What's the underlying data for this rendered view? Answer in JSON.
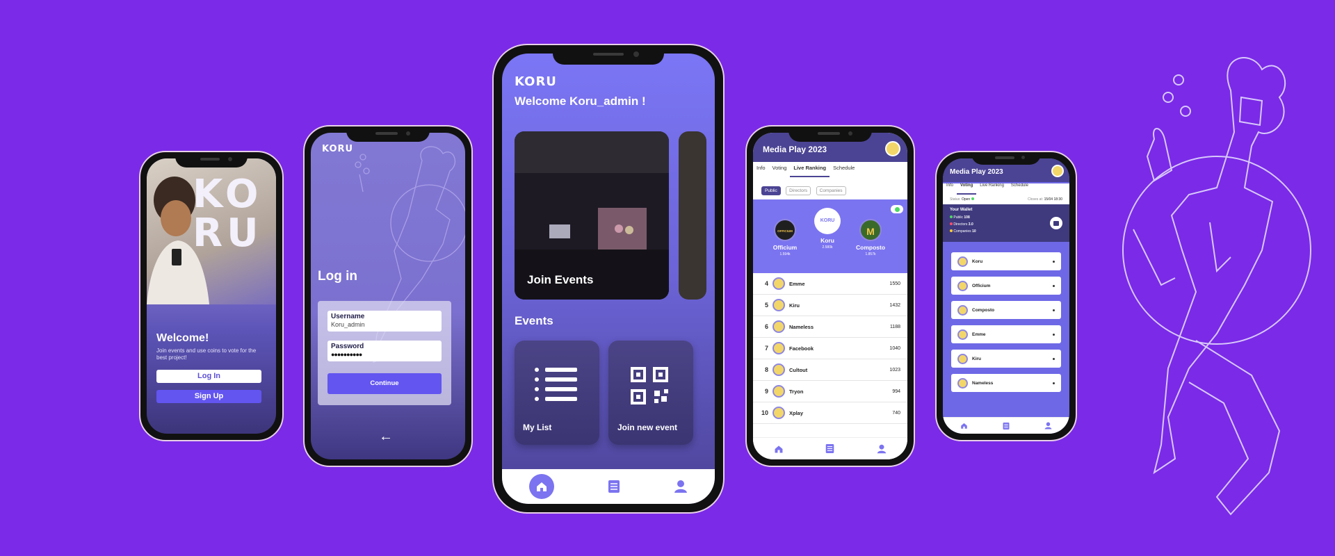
{
  "phone1": {
    "logo": "KO RU",
    "welcome": "Welcome!",
    "subtitle": "Join events and use coins to vote for the best project!",
    "login_label": "Log In",
    "signup_label": "Sign Up"
  },
  "phone2": {
    "logo": "KORU",
    "title": "Log in",
    "username_label": "Username",
    "username_value": "Koru_admin",
    "password_label": "Password",
    "password_value": "●●●●●●●●●●",
    "continue_label": "Continue",
    "back_glyph": "←"
  },
  "phone3": {
    "logo": "KORU",
    "greeting": "Welcome Koru_admin !",
    "card_label": "Join Events",
    "events_heading": "Events",
    "tile_mylist": "My List",
    "tile_join": "Join new event"
  },
  "phone4": {
    "title": "Media Play 2023",
    "tabs": [
      "Info",
      "Voting",
      "Live Ranking",
      "Schedule"
    ],
    "chips": [
      "Public",
      "Directors",
      "Companies"
    ],
    "podium": [
      {
        "name": "Officium",
        "score": "1.594k",
        "place": "2",
        "mark": "OFFICIUM"
      },
      {
        "name": "Koru",
        "score": "2.580k",
        "place": "1",
        "mark": "KORU"
      },
      {
        "name": "Composto",
        "score": "1.857k",
        "place": "3",
        "mark": "M"
      }
    ],
    "rows": [
      {
        "rank": "4",
        "name": "Emme",
        "score": "1550"
      },
      {
        "rank": "5",
        "name": "Kiru",
        "score": "1432"
      },
      {
        "rank": "6",
        "name": "Nameless",
        "score": "1188"
      },
      {
        "rank": "7",
        "name": "Facebook",
        "score": "1040"
      },
      {
        "rank": "8",
        "name": "Cultout",
        "score": "1023"
      },
      {
        "rank": "9",
        "name": "Tryon",
        "score": "994"
      },
      {
        "rank": "10",
        "name": "Xplay",
        "score": "740"
      }
    ]
  },
  "phone5": {
    "title": "Media Play 2023",
    "tabs": [
      "Info",
      "Voting",
      "Live Ranking",
      "Schedule"
    ],
    "status_label": "Status:",
    "status_value": "Open",
    "closes_label": "Closes at:",
    "closes_value": "15/04 18:30",
    "wallet_title": "Your Wallet",
    "wallet": [
      {
        "label": "Public",
        "value": "108",
        "color": "#4cd964"
      },
      {
        "label": "Directors",
        "value": "3.0",
        "color": "#ff4d6d"
      },
      {
        "label": "Companies",
        "value": "10",
        "color": "#ffcc33"
      }
    ],
    "candidates": [
      "Koru",
      "Officium",
      "Composto",
      "Emme",
      "Kiru",
      "Nameless"
    ]
  },
  "colors": {
    "background": "#7b2ae8",
    "accent": "#6255f0",
    "header": "#4b4494"
  }
}
